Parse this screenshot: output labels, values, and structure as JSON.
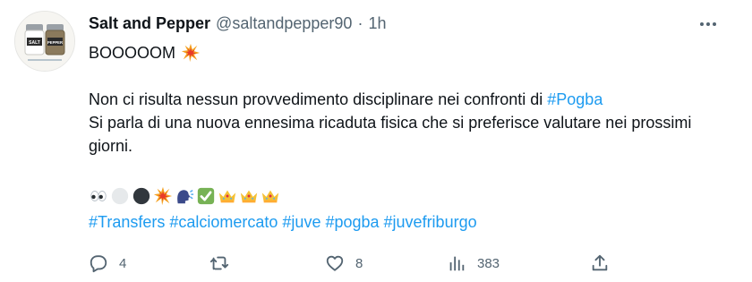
{
  "tweet": {
    "author": {
      "display_name": "Salt and Pepper",
      "handle": "@saltandpepper90",
      "separator": "·",
      "time": "1h",
      "avatar": {
        "salt_label": "SALT",
        "pepper_label": "PEPPER"
      }
    },
    "more_icon": "more-horizontal-icon",
    "text": {
      "line1": "BOOOOOM",
      "line1_emoji": "collision-emoji",
      "para2_prefix": "Non ci risulta nessun provvedimento disciplinare nei confronti di ",
      "para2_hashtag": "#Pogba",
      "para2_rest": "Si parla di una nuova ennesima ricaduta fisica che si preferisce valutare nei prossimi giorni."
    },
    "emoji_row": [
      "eyes-emoji",
      "white-circle-emoji",
      "black-circle-emoji",
      "collision-emoji",
      "speaking-head-emoji",
      "check-mark-button-emoji",
      "crown-emoji",
      "crown-emoji",
      "crown-emoji"
    ],
    "hashtags": [
      "#Transfers",
      "#calciomercato",
      "#juve",
      "#pogba",
      "#juvefriburgo"
    ],
    "actions": {
      "reply": {
        "icon": "reply-icon",
        "count": "4"
      },
      "retweet": {
        "icon": "retweet-icon",
        "count": ""
      },
      "like": {
        "icon": "heart-icon",
        "count": "8"
      },
      "views": {
        "icon": "views-chart-icon",
        "count": "383"
      },
      "share": {
        "icon": "share-icon",
        "count": ""
      }
    },
    "colors": {
      "link": "#1d9bf0",
      "secondary": "#536471",
      "text": "#0f1419"
    }
  }
}
